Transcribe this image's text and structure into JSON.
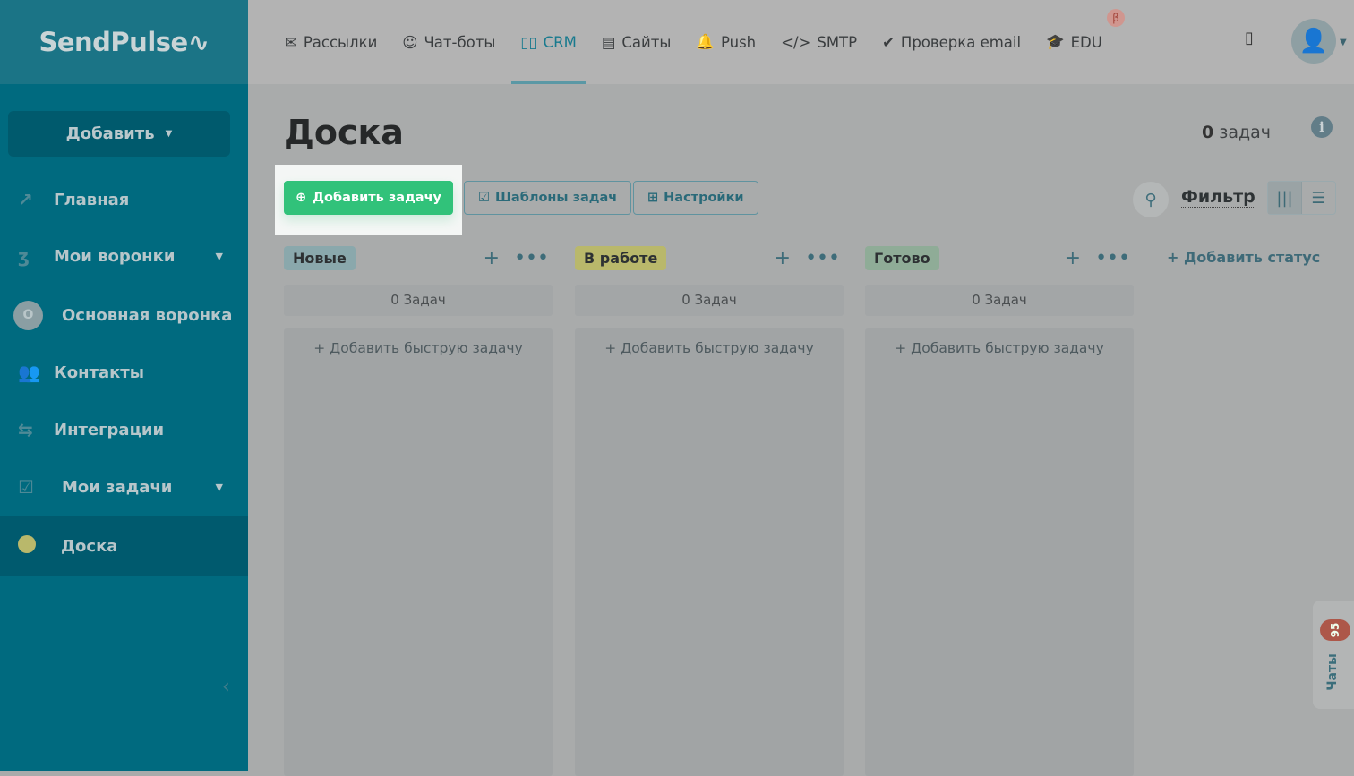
{
  "logo": "SendPulse",
  "sidebar": {
    "add": "Добавить",
    "items": [
      {
        "label": "Главная",
        "icon": "chart-line-icon"
      },
      {
        "label": "Мои воронки",
        "icon": "funnel-icon"
      },
      {
        "label": "Основная воронка",
        "icon": "circle-o-icon",
        "prefix": "O"
      },
      {
        "label": "Контакты",
        "icon": "contacts-icon"
      },
      {
        "label": "Интеграции",
        "icon": "arrows-icon"
      },
      {
        "label": "Мои задачи",
        "icon": "checkbox-icon"
      },
      {
        "label": "Доска",
        "icon": "dot-icon"
      }
    ]
  },
  "nav": {
    "tabs": [
      {
        "label": "Рассылки",
        "icon": "✉"
      },
      {
        "label": "Чат-боты",
        "icon": "☺"
      },
      {
        "label": "CRM",
        "icon": "▯"
      },
      {
        "label": "Сайты",
        "icon": "▤"
      },
      {
        "label": "Push",
        "icon": "🔔"
      },
      {
        "label": "SMTP",
        "icon": "</>"
      },
      {
        "label": "Проверка email",
        "icon": "✔"
      },
      {
        "label": "EDU",
        "icon": "🎓"
      }
    ],
    "beta": "β"
  },
  "page": {
    "title": "Доска",
    "count_num": "0",
    "count_label": "задач",
    "add_task": "Добавить задачу",
    "templates": "Шаблоны задач",
    "settings": "Настройки",
    "filter": "Фильтр",
    "add_status": "Добавить статус"
  },
  "columns": [
    {
      "name": "Новые",
      "color": "#8aa8ac",
      "count": "0 Задач",
      "quick": "Добавить быструю задачу"
    },
    {
      "name": "В работе",
      "color": "#b9b86b",
      "count": "0 Задач",
      "quick": "Добавить быструю задачу"
    },
    {
      "name": "Готово",
      "color": "#8fac97",
      "count": "0 Задач",
      "quick": "Добавить быструю задачу"
    }
  ],
  "chats": {
    "label": "Чаты",
    "count": "95"
  }
}
